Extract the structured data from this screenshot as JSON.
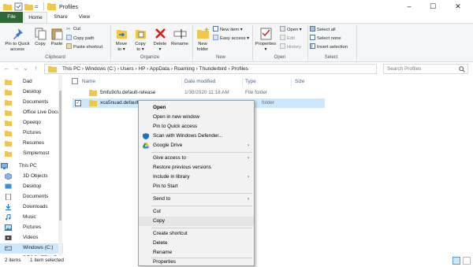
{
  "window": {
    "title": "Profiles",
    "controls": {
      "minimize": "–",
      "maximize": "☐",
      "close": "✕"
    }
  },
  "quick_access": {
    "dropdown": "="
  },
  "tabs": {
    "file": "File",
    "home": "Home",
    "share": "Share",
    "view": "View"
  },
  "ribbon": {
    "clipboard": {
      "label": "Clipboard",
      "pin": [
        "Pin to Quick",
        "access"
      ],
      "copy": "Copy",
      "paste": "Paste",
      "cut": "Cut",
      "copy_path": "Copy path",
      "paste_shortcut": "Paste shortcut"
    },
    "organize": {
      "label": "Organize",
      "move_to": [
        "Move",
        "to ▾"
      ],
      "copy_to": [
        "Copy",
        "to ▾"
      ],
      "delete": [
        "Delete",
        "▾"
      ],
      "rename": "Rename"
    },
    "new": {
      "label": "New",
      "new_folder": [
        "New",
        "folder"
      ],
      "new_item": "New item ▾",
      "easy_access": "Easy access ▾"
    },
    "open": {
      "label": "Open",
      "properties": [
        "Properties",
        "▾"
      ],
      "open": "Open ▾",
      "edit": "Edit",
      "history": "History"
    },
    "select": {
      "label": "Select",
      "select_all": "Select all",
      "select_none": "Select none",
      "invert": "Invert selection"
    }
  },
  "nav_buttons": {
    "back": "←",
    "forward": "→",
    "recent": "⌄",
    "up": "↑"
  },
  "address": {
    "path": "This PC  ›  Windows (C:)  ›  Users  ›  HP  ›  AppData  ›  Roaming  ›  Thunderbird  ›  Profiles",
    "dropdown": "⌄",
    "refresh": "↻"
  },
  "search": {
    "placeholder": "Search Profiles"
  },
  "nav_pane": {
    "items": [
      {
        "label": "Dad",
        "icon": "folder"
      },
      {
        "label": "Desktop",
        "icon": "folder"
      },
      {
        "label": "Documents",
        "icon": "folder"
      },
      {
        "label": "Office Live Docu",
        "icon": "folder"
      },
      {
        "label": "Opeeqo",
        "icon": "folder"
      },
      {
        "label": "Pictures",
        "icon": "folder"
      },
      {
        "label": "Resumes",
        "icon": "folder"
      },
      {
        "label": "Simplemost",
        "icon": "folder"
      },
      {
        "label": "This PC",
        "icon": "pc"
      },
      {
        "label": "3D Objects",
        "icon": "3d"
      },
      {
        "label": "Desktop",
        "icon": "desktop"
      },
      {
        "label": "Documents",
        "icon": "documents"
      },
      {
        "label": "Downloads",
        "icon": "downloads"
      },
      {
        "label": "Music",
        "icon": "music"
      },
      {
        "label": "Pictures",
        "icon": "pictures"
      },
      {
        "label": "Videos",
        "icon": "videos"
      },
      {
        "label": "Windows (C:)",
        "icon": "drive"
      },
      {
        "label": "RECOVERY (D:)",
        "icon": "drive"
      }
    ]
  },
  "columns": {
    "name": "Name",
    "date": "Date modified",
    "type": "Type",
    "size": "Size"
  },
  "files": [
    {
      "name": "5mfu9cfu.default-release",
      "date": "1/30/2020 11:18 AM",
      "type": "File folder",
      "selected": false
    },
    {
      "name": "xca5nuad.default",
      "date": "",
      "type": "folder",
      "selected": true
    }
  ],
  "context_menu": {
    "open": "Open",
    "open_new_window": "Open in new window",
    "pin_quick": "Pin to Quick access",
    "scan": "Scan with Windows Defender...",
    "google_drive": "Google Drive",
    "give_access": "Give access to",
    "restore": "Restore previous versions",
    "include_library": "Include in library",
    "pin_start": "Pin to Start",
    "send_to": "Send to",
    "cut": "Cut",
    "copy": "Copy",
    "create_shortcut": "Create shortcut",
    "delete": "Delete",
    "rename": "Rename",
    "properties": "Properties",
    "submenu_arrow": "›"
  },
  "status": {
    "items": "2 items",
    "selected": "1 item selected"
  },
  "colors": {
    "file_tab": "#2d6a33",
    "selection": "#cce8ff",
    "folder": "#f0c64b",
    "accent": "#1a73c7"
  }
}
